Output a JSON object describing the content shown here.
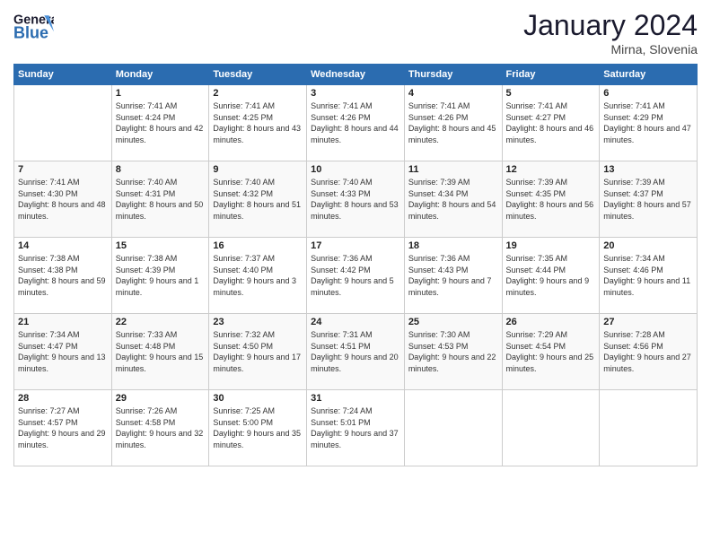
{
  "header": {
    "logo_general": "General",
    "logo_blue": "Blue",
    "month_year": "January 2024",
    "location": "Mirna, Slovenia"
  },
  "days_of_week": [
    "Sunday",
    "Monday",
    "Tuesday",
    "Wednesday",
    "Thursday",
    "Friday",
    "Saturday"
  ],
  "weeks": [
    [
      {
        "day": "",
        "sunrise": "",
        "sunset": "",
        "daylight": ""
      },
      {
        "day": "1",
        "sunrise": "Sunrise: 7:41 AM",
        "sunset": "Sunset: 4:24 PM",
        "daylight": "Daylight: 8 hours and 42 minutes."
      },
      {
        "day": "2",
        "sunrise": "Sunrise: 7:41 AM",
        "sunset": "Sunset: 4:25 PM",
        "daylight": "Daylight: 8 hours and 43 minutes."
      },
      {
        "day": "3",
        "sunrise": "Sunrise: 7:41 AM",
        "sunset": "Sunset: 4:26 PM",
        "daylight": "Daylight: 8 hours and 44 minutes."
      },
      {
        "day": "4",
        "sunrise": "Sunrise: 7:41 AM",
        "sunset": "Sunset: 4:26 PM",
        "daylight": "Daylight: 8 hours and 45 minutes."
      },
      {
        "day": "5",
        "sunrise": "Sunrise: 7:41 AM",
        "sunset": "Sunset: 4:27 PM",
        "daylight": "Daylight: 8 hours and 46 minutes."
      },
      {
        "day": "6",
        "sunrise": "Sunrise: 7:41 AM",
        "sunset": "Sunset: 4:29 PM",
        "daylight": "Daylight: 8 hours and 47 minutes."
      }
    ],
    [
      {
        "day": "7",
        "sunrise": "Sunrise: 7:41 AM",
        "sunset": "Sunset: 4:30 PM",
        "daylight": "Daylight: 8 hours and 48 minutes."
      },
      {
        "day": "8",
        "sunrise": "Sunrise: 7:40 AM",
        "sunset": "Sunset: 4:31 PM",
        "daylight": "Daylight: 8 hours and 50 minutes."
      },
      {
        "day": "9",
        "sunrise": "Sunrise: 7:40 AM",
        "sunset": "Sunset: 4:32 PM",
        "daylight": "Daylight: 8 hours and 51 minutes."
      },
      {
        "day": "10",
        "sunrise": "Sunrise: 7:40 AM",
        "sunset": "Sunset: 4:33 PM",
        "daylight": "Daylight: 8 hours and 53 minutes."
      },
      {
        "day": "11",
        "sunrise": "Sunrise: 7:39 AM",
        "sunset": "Sunset: 4:34 PM",
        "daylight": "Daylight: 8 hours and 54 minutes."
      },
      {
        "day": "12",
        "sunrise": "Sunrise: 7:39 AM",
        "sunset": "Sunset: 4:35 PM",
        "daylight": "Daylight: 8 hours and 56 minutes."
      },
      {
        "day": "13",
        "sunrise": "Sunrise: 7:39 AM",
        "sunset": "Sunset: 4:37 PM",
        "daylight": "Daylight: 8 hours and 57 minutes."
      }
    ],
    [
      {
        "day": "14",
        "sunrise": "Sunrise: 7:38 AM",
        "sunset": "Sunset: 4:38 PM",
        "daylight": "Daylight: 8 hours and 59 minutes."
      },
      {
        "day": "15",
        "sunrise": "Sunrise: 7:38 AM",
        "sunset": "Sunset: 4:39 PM",
        "daylight": "Daylight: 9 hours and 1 minute."
      },
      {
        "day": "16",
        "sunrise": "Sunrise: 7:37 AM",
        "sunset": "Sunset: 4:40 PM",
        "daylight": "Daylight: 9 hours and 3 minutes."
      },
      {
        "day": "17",
        "sunrise": "Sunrise: 7:36 AM",
        "sunset": "Sunset: 4:42 PM",
        "daylight": "Daylight: 9 hours and 5 minutes."
      },
      {
        "day": "18",
        "sunrise": "Sunrise: 7:36 AM",
        "sunset": "Sunset: 4:43 PM",
        "daylight": "Daylight: 9 hours and 7 minutes."
      },
      {
        "day": "19",
        "sunrise": "Sunrise: 7:35 AM",
        "sunset": "Sunset: 4:44 PM",
        "daylight": "Daylight: 9 hours and 9 minutes."
      },
      {
        "day": "20",
        "sunrise": "Sunrise: 7:34 AM",
        "sunset": "Sunset: 4:46 PM",
        "daylight": "Daylight: 9 hours and 11 minutes."
      }
    ],
    [
      {
        "day": "21",
        "sunrise": "Sunrise: 7:34 AM",
        "sunset": "Sunset: 4:47 PM",
        "daylight": "Daylight: 9 hours and 13 minutes."
      },
      {
        "day": "22",
        "sunrise": "Sunrise: 7:33 AM",
        "sunset": "Sunset: 4:48 PM",
        "daylight": "Daylight: 9 hours and 15 minutes."
      },
      {
        "day": "23",
        "sunrise": "Sunrise: 7:32 AM",
        "sunset": "Sunset: 4:50 PM",
        "daylight": "Daylight: 9 hours and 17 minutes."
      },
      {
        "day": "24",
        "sunrise": "Sunrise: 7:31 AM",
        "sunset": "Sunset: 4:51 PM",
        "daylight": "Daylight: 9 hours and 20 minutes."
      },
      {
        "day": "25",
        "sunrise": "Sunrise: 7:30 AM",
        "sunset": "Sunset: 4:53 PM",
        "daylight": "Daylight: 9 hours and 22 minutes."
      },
      {
        "day": "26",
        "sunrise": "Sunrise: 7:29 AM",
        "sunset": "Sunset: 4:54 PM",
        "daylight": "Daylight: 9 hours and 25 minutes."
      },
      {
        "day": "27",
        "sunrise": "Sunrise: 7:28 AM",
        "sunset": "Sunset: 4:56 PM",
        "daylight": "Daylight: 9 hours and 27 minutes."
      }
    ],
    [
      {
        "day": "28",
        "sunrise": "Sunrise: 7:27 AM",
        "sunset": "Sunset: 4:57 PM",
        "daylight": "Daylight: 9 hours and 29 minutes."
      },
      {
        "day": "29",
        "sunrise": "Sunrise: 7:26 AM",
        "sunset": "Sunset: 4:58 PM",
        "daylight": "Daylight: 9 hours and 32 minutes."
      },
      {
        "day": "30",
        "sunrise": "Sunrise: 7:25 AM",
        "sunset": "Sunset: 5:00 PM",
        "daylight": "Daylight: 9 hours and 35 minutes."
      },
      {
        "day": "31",
        "sunrise": "Sunrise: 7:24 AM",
        "sunset": "Sunset: 5:01 PM",
        "daylight": "Daylight: 9 hours and 37 minutes."
      },
      {
        "day": "",
        "sunrise": "",
        "sunset": "",
        "daylight": ""
      },
      {
        "day": "",
        "sunrise": "",
        "sunset": "",
        "daylight": ""
      },
      {
        "day": "",
        "sunrise": "",
        "sunset": "",
        "daylight": ""
      }
    ]
  ]
}
